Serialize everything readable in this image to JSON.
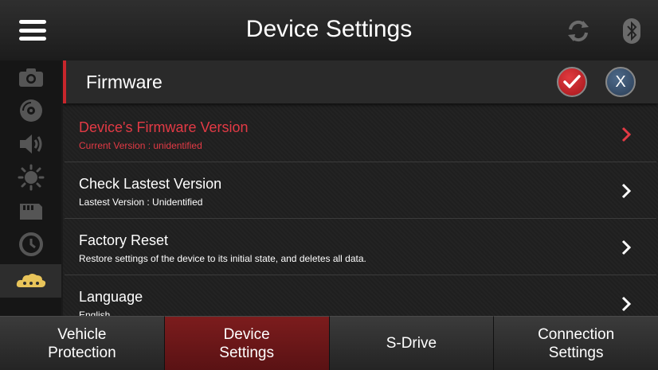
{
  "header": {
    "title": "Device Settings",
    "icons": [
      "menu-icon",
      "sync-icon",
      "bluetooth-icon"
    ]
  },
  "sidebar": {
    "items": [
      {
        "icon": "camera-icon"
      },
      {
        "icon": "disc-icon"
      },
      {
        "icon": "speaker-icon"
      },
      {
        "icon": "brightness-icon"
      },
      {
        "icon": "sd-card-icon"
      },
      {
        "icon": "clock-icon"
      },
      {
        "icon": "cloud-icon",
        "active": true
      }
    ]
  },
  "section": {
    "title": "Firmware",
    "confirm_icon": "checkmark-icon",
    "cancel_label": "X"
  },
  "rows": [
    {
      "title": "Device's Firmware Version",
      "subtitle": "Current Version : unidentified",
      "highlight": true
    },
    {
      "title": "Check Lastest Version",
      "subtitle": "Lastest Version : Unidentified"
    },
    {
      "title": "Factory Reset",
      "subtitle": "Restore settings of the device to its initial state, and deletes all data."
    },
    {
      "title": "Language",
      "subtitle": "English"
    }
  ],
  "tabs": [
    {
      "label": "Vehicle\nProtection"
    },
    {
      "label": "Device\nSettings",
      "active": true
    },
    {
      "label": "S-Drive"
    },
    {
      "label": "Connection\nSettings"
    }
  ],
  "colors": {
    "accent_red": "#c8262c",
    "highlight_text": "#e33a45",
    "active_tab": "#6e1818",
    "cancel_blue": "#3f5876",
    "cloud_gold": "#e8c45a"
  }
}
